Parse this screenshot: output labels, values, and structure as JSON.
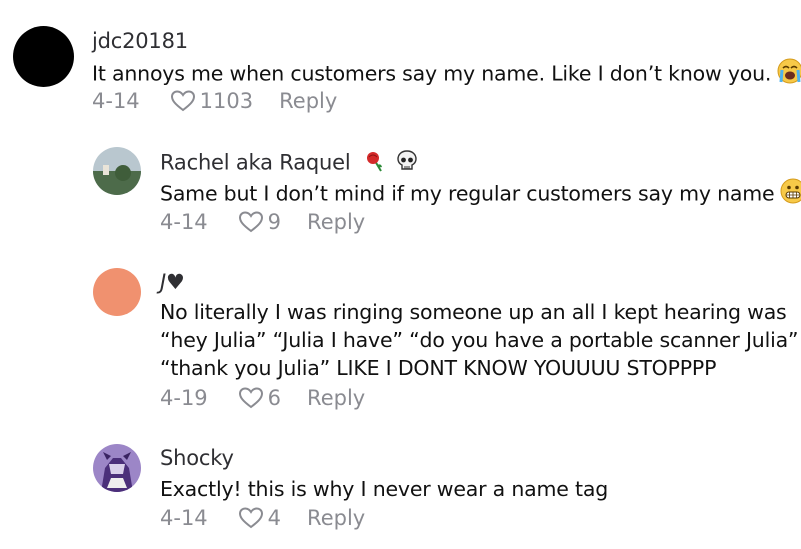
{
  "comments": [
    {
      "username": "jdc20181",
      "text_lines": [
        "It annoys me when customers say my name. Like I don’t know you."
      ],
      "emoji": "crying-face",
      "date": "4-14",
      "likes": "1103",
      "reply_label": "Reply",
      "avatar_color": "#000000"
    },
    {
      "username": "Rachel aka Raquel",
      "text_lines": [
        "Same but I don’t mind if my regular customers say my name"
      ],
      "emoji": "grimacing-face",
      "date": "4-14",
      "likes": "9",
      "reply_label": "Reply",
      "avatar_color": "#7a8e86"
    },
    {
      "username": "J♥",
      "text_lines": [
        "No literally I was ringing someone up an all I kept hearing was",
        "“hey Julia” “Julia I have” “do you have a portable scanner Julia”",
        "“thank you Julia” LIKE I DONT KNOW YOUUUU STOPPPP"
      ],
      "date": "4-19",
      "likes": "6",
      "reply_label": "Reply",
      "avatar_color": "#f0916f"
    },
    {
      "username": "Shocky",
      "text_lines": [
        "Exactly! this is why I never wear a name tag"
      ],
      "date": "4-14",
      "likes": "4",
      "reply_label": "Reply",
      "avatar_color": "#7d5fa6"
    }
  ]
}
